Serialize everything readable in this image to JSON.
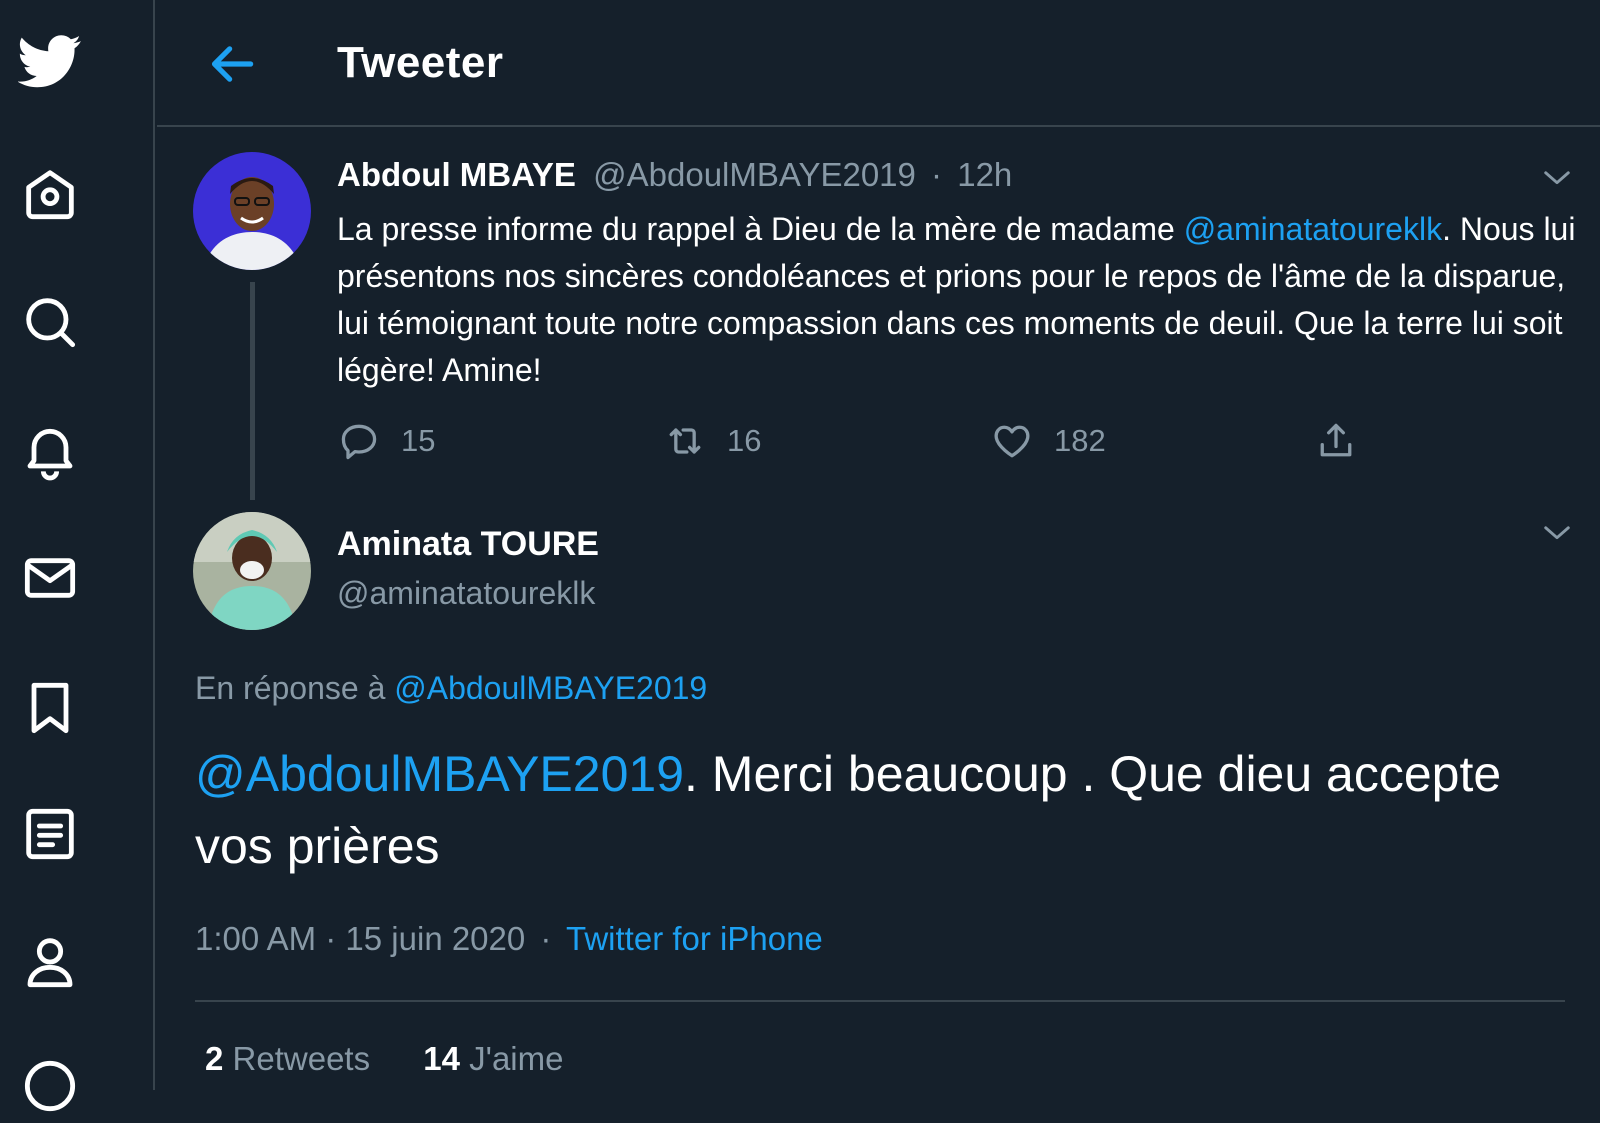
{
  "header": {
    "title": "Tweeter"
  },
  "nav": {
    "icons": [
      "twitter-logo-icon",
      "home-icon",
      "search-icon",
      "bell-icon",
      "mail-icon",
      "bookmark-icon",
      "list-icon",
      "profile-icon",
      "more-icon"
    ]
  },
  "tweet1": {
    "name": "Abdoul MBAYE",
    "handle": "@AbdoulMBAYE2019",
    "sep": "·",
    "time": "12h",
    "text_part1": "La presse informe du rappel à Dieu de la mère de madame ",
    "mention": "@aminatatoureklk",
    "text_part2": ". Nous lui présentons nos sincères condoléances et prions pour le repos de l'âme de la disparue, lui témoignant toute notre compassion dans ces moments de deuil. Que la terre lui soit légère! Amine!",
    "replies": "15",
    "retweets": "16",
    "likes": "182"
  },
  "tweet2": {
    "name": "Aminata TOURE",
    "handle": "@aminatatoureklk",
    "reply_prefix": "En réponse à ",
    "reply_handle": "@AbdoulMBAYE2019",
    "mention": "@AbdoulMBAYE2019",
    "text": ". Merci beaucoup . Que dieu accepte vos prières",
    "time": "1:00 AM",
    "sep1": "·",
    "date": "15 juin 2020",
    "sep2": "·",
    "source": "Twitter for iPhone",
    "retweets_count": "2",
    "retweets_label": "Retweets",
    "likes_count": "14",
    "likes_label": "J'aime"
  },
  "colors": {
    "background": "#15202b",
    "accent": "#1da1f2",
    "muted": "#8899a6",
    "border": "#38444d"
  }
}
